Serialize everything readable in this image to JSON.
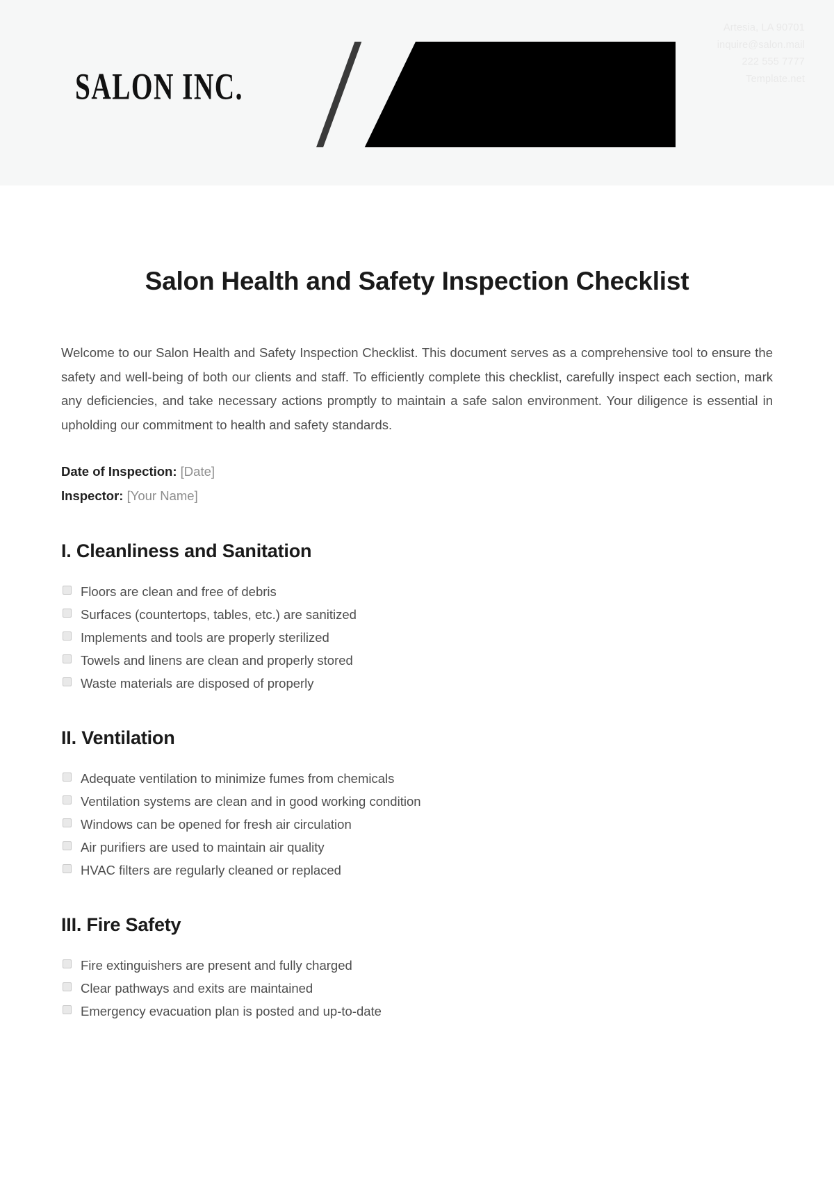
{
  "header": {
    "logo": "SALON INC.",
    "contact": [
      "Artesia, LA 90701",
      "inquire@salon.mail",
      "222 555 7777",
      "Template.net"
    ]
  },
  "document": {
    "title": "Salon Health and Safety Inspection Checklist",
    "intro": "Welcome to our Salon Health and Safety Inspection Checklist. This document serves as a comprehensive tool to ensure the safety and well-being of both our clients and staff. To efficiently complete this checklist, carefully inspect each section, mark any deficiencies, and take necessary actions promptly to maintain a safe salon environment. Your diligence is essential in upholding our commitment to health and safety standards.",
    "fields": [
      {
        "label": "Date of Inspection:",
        "value": "[Date]"
      },
      {
        "label": "Inspector:",
        "value": "[Your Name]"
      }
    ],
    "sections": [
      {
        "heading": "I. Cleanliness and Sanitation",
        "items": [
          "Floors are clean and free of debris",
          "Surfaces (countertops, tables, etc.) are sanitized",
          "Implements and tools are properly sterilized",
          "Towels and linens are clean and properly stored",
          "Waste materials are disposed of properly"
        ]
      },
      {
        "heading": "II. Ventilation",
        "items": [
          "Adequate ventilation to minimize fumes from chemicals",
          "Ventilation systems are clean and in good working condition",
          "Windows can be opened for fresh air circulation",
          "Air purifiers are used to maintain air quality",
          "HVAC filters are regularly cleaned or replaced"
        ]
      },
      {
        "heading": "III. Fire Safety",
        "items": [
          "Fire extinguishers are present and fully charged",
          "Clear pathways and exits are maintained",
          "Emergency evacuation plan is posted and up-to-date"
        ]
      }
    ]
  },
  "colors": {
    "header_bg": "#f6f7f7",
    "contact_block": "#000000",
    "body_text": "#4d4d4d",
    "heading_text": "#1a1a1a",
    "placeholder_text": "#8d8d8d",
    "checkbox_fill": "#e9e9e9"
  }
}
